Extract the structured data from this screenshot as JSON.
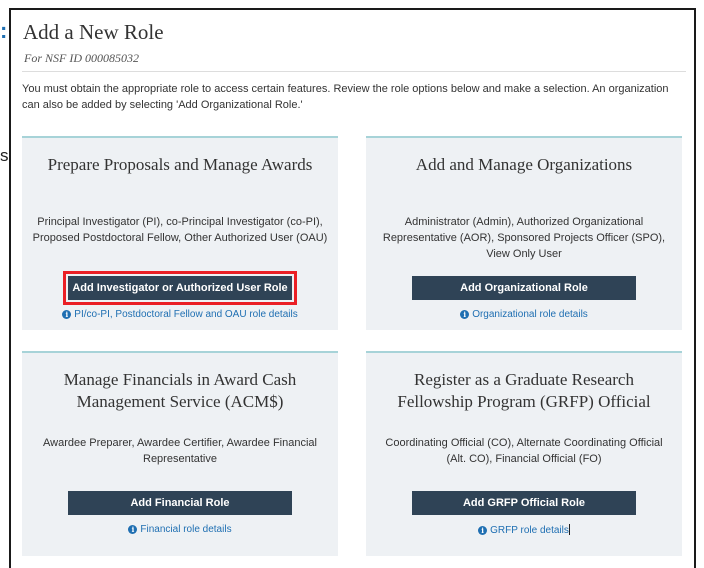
{
  "edge_fragments": {
    "colon": ":",
    "letter": "s"
  },
  "page": {
    "title": "Add a New Role",
    "subtitle": "For NSF ID 000085032",
    "intro": "You must obtain the appropriate role to access certain features. Review the role options below and make a selection. An organization can also be added by selecting 'Add Organizational Role.'"
  },
  "cards": [
    {
      "title": "Prepare Proposals and Manage Awards",
      "description": "Principal Investigator (PI), co-Principal Investigator (co-PI), Proposed Postdoctoral Fellow, Other Authorized User (OAU)",
      "button": "Add Investigator or Authorized User Role",
      "link": "PI/co-PI, Postdoctoral Fellow and OAU role details",
      "highlighted": true
    },
    {
      "title": "Add and Manage Organizations",
      "description": "Administrator (Admin), Authorized Organizational Representative (AOR), Sponsored Projects Officer (SPO), View Only User",
      "button": "Add Organizational Role",
      "link": "Organizational role details",
      "highlighted": false
    },
    {
      "title": "Manage Financials in Award Cash Management Service (ACM$)",
      "description": "Awardee Preparer, Awardee Certifier, Awardee Financial Representative",
      "button": "Add Financial Role",
      "link": "Financial role details",
      "highlighted": false
    },
    {
      "title": "Register as a Graduate Research Fellowship Program (GRFP) Official",
      "description": "Coordinating Official (CO), Alternate Coordinating Official (Alt. CO), Financial Official (FO)",
      "button": "Add GRFP Official Role",
      "link": "GRFP role details",
      "highlighted": false
    }
  ],
  "icons": {
    "info": "info-circle-icon"
  },
  "colors": {
    "button_bg": "#2f4356",
    "card_bg": "#eef1f4",
    "card_accent": "#a7d3d8",
    "link": "#1f6fb2",
    "highlight": "#ea1f25"
  }
}
